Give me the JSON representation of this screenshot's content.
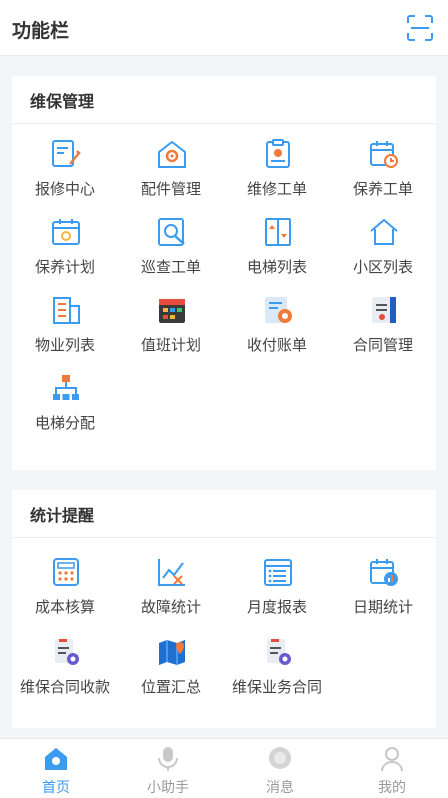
{
  "header": {
    "title": "功能栏",
    "scan_icon": "scan-icon"
  },
  "sections": [
    {
      "title": "维保管理",
      "items": [
        {
          "label": "报修中心",
          "icon": "repair-request-icon"
        },
        {
          "label": "配件管理",
          "icon": "parts-icon"
        },
        {
          "label": "维修工单",
          "icon": "repair-order-icon"
        },
        {
          "label": "保养工单",
          "icon": "maintenance-order-icon"
        },
        {
          "label": "保养计划",
          "icon": "maintenance-plan-icon"
        },
        {
          "label": "巡查工单",
          "icon": "inspection-icon"
        },
        {
          "label": "电梯列表",
          "icon": "elevator-list-icon"
        },
        {
          "label": "小区列表",
          "icon": "community-list-icon"
        },
        {
          "label": "物业列表",
          "icon": "property-list-icon"
        },
        {
          "label": "值班计划",
          "icon": "duty-plan-icon"
        },
        {
          "label": "收付账单",
          "icon": "bill-icon"
        },
        {
          "label": "合同管理",
          "icon": "contract-icon"
        },
        {
          "label": "电梯分配",
          "icon": "elevator-assign-icon"
        }
      ]
    },
    {
      "title": "统计提醒",
      "items": [
        {
          "label": "成本核算",
          "icon": "cost-icon"
        },
        {
          "label": "故障统计",
          "icon": "fault-stats-icon"
        },
        {
          "label": "月度报表",
          "icon": "monthly-report-icon"
        },
        {
          "label": "日期统计",
          "icon": "date-stats-icon"
        },
        {
          "label": "维保合同收款",
          "icon": "contract-payment-icon"
        },
        {
          "label": "位置汇总",
          "icon": "location-summary-icon"
        },
        {
          "label": "维保业务合同",
          "icon": "business-contract-icon"
        }
      ]
    }
  ],
  "tabbar": [
    {
      "label": "首页",
      "icon": "home-icon",
      "active": true
    },
    {
      "label": "小助手",
      "icon": "assistant-icon",
      "active": false
    },
    {
      "label": "消息",
      "icon": "message-icon",
      "active": false
    },
    {
      "label": "我的",
      "icon": "profile-icon",
      "active": false
    }
  ],
  "colors": {
    "accent": "#3a9bf0",
    "orange": "#f07a3a",
    "inactive": "#c8c8c8"
  }
}
